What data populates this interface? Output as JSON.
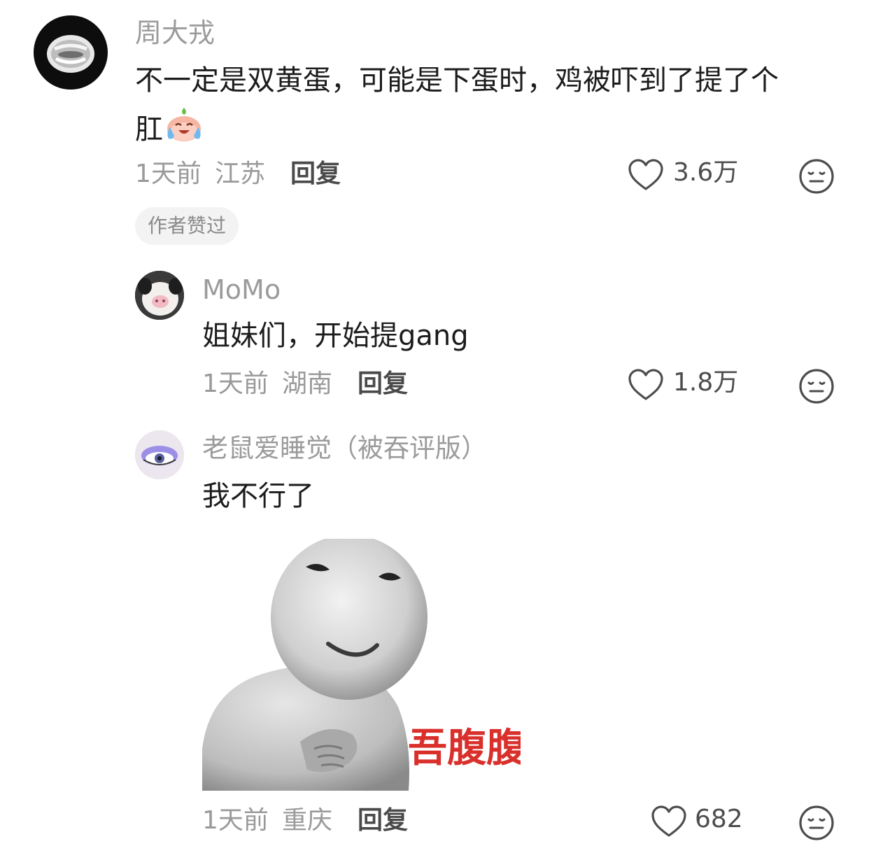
{
  "comment": {
    "username": "周大戎",
    "content_line1": "不一定是双黄蛋，可能是下蛋时，鸡被吓到了提了个",
    "content_line2": "肛",
    "time": "1天前",
    "location": "江苏",
    "reply_label": "回复",
    "likes": "3.6万",
    "badge": "作者赞过"
  },
  "replies": [
    {
      "username": "MoMo",
      "content": "姐妹们，开始提gang",
      "time": "1天前",
      "location": "湖南",
      "reply_label": "回复",
      "likes": "1.8万"
    },
    {
      "username": "老鼠爱睡觉（被吞评版）",
      "content": "我不行了",
      "sticker_text": "吾腹腹",
      "time": "1天前",
      "location": "重庆",
      "reply_label": "回复",
      "likes": "682"
    }
  ],
  "colors": {
    "username": "#9b9b9b",
    "text": "#1c1c1c",
    "meta": "#9a9a9a",
    "sticker_text": "#d9302c",
    "badge_bg": "#f3f3f3"
  },
  "icons": [
    "heart-outline-icon",
    "neutral-face-icon",
    "crying-laughing-emoji"
  ]
}
